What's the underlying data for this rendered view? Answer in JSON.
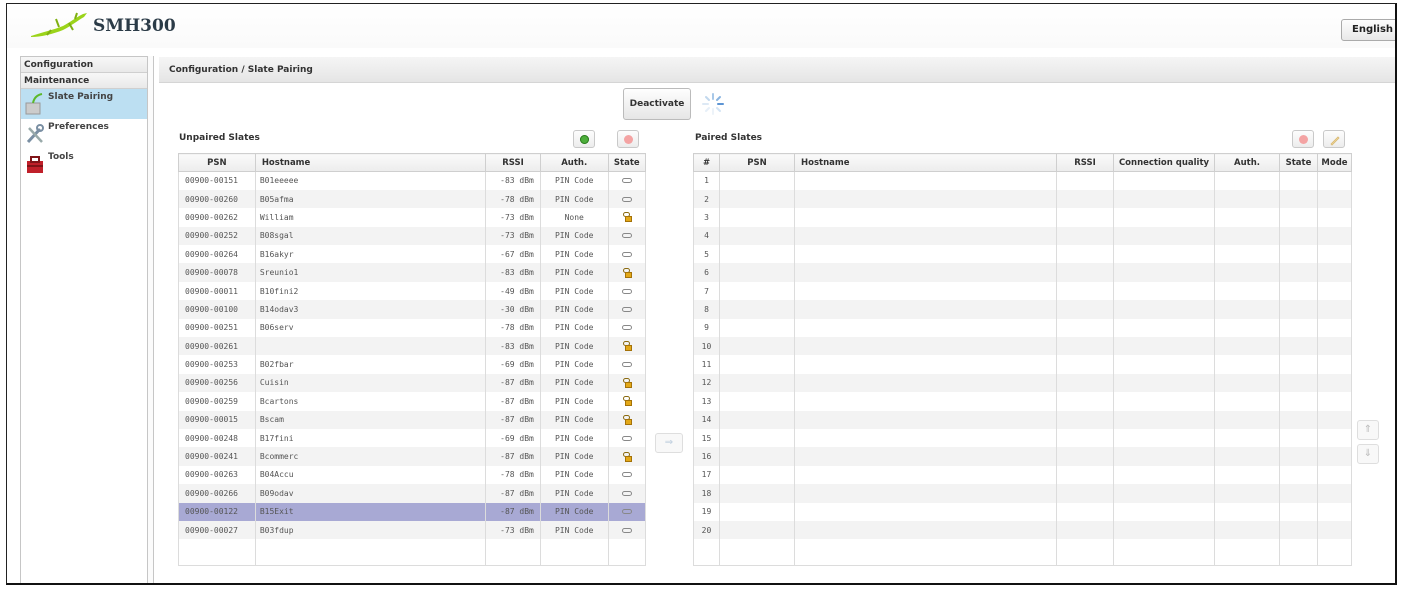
{
  "app": {
    "name": "SMH300"
  },
  "language": {
    "selected": "English"
  },
  "sidebar": {
    "sections": [
      {
        "label": "Configuration"
      },
      {
        "label": "Maintenance"
      }
    ],
    "items": [
      {
        "label": "Slate Pairing",
        "icon": "slate-pairing-icon",
        "active": true
      },
      {
        "label": "Preferences",
        "icon": "tools-wrench-icon"
      },
      {
        "label": "Tools",
        "icon": "toolbox-icon"
      }
    ]
  },
  "breadcrumb": "Configuration / Slate Pairing",
  "actions": {
    "deactivate_label": "Deactivate"
  },
  "unpaired": {
    "title": "Unpaired Slates",
    "columns": [
      "PSN",
      "Hostname",
      "RSSI",
      "Auth.",
      "State"
    ],
    "rows": [
      {
        "psn": "00900-00151",
        "host": "B01eeeee",
        "rssi": "-83 dBm",
        "auth": "PIN Code",
        "state": "link"
      },
      {
        "psn": "00900-00260",
        "host": "B05afma",
        "rssi": "-78 dBm",
        "auth": "PIN Code",
        "state": "link"
      },
      {
        "psn": "00900-00262",
        "host": "William",
        "rssi": "-73 dBm",
        "auth": "None",
        "state": "lock"
      },
      {
        "psn": "00900-00252",
        "host": "B08sgal",
        "rssi": "-73 dBm",
        "auth": "PIN Code",
        "state": "link"
      },
      {
        "psn": "00900-00264",
        "host": "B16akyr",
        "rssi": "-67 dBm",
        "auth": "PIN Code",
        "state": "link"
      },
      {
        "psn": "00900-00078",
        "host": "Sreunio1",
        "rssi": "-83 dBm",
        "auth": "PIN Code",
        "state": "lock"
      },
      {
        "psn": "00900-00011",
        "host": "B10fini2",
        "rssi": "-49 dBm",
        "auth": "PIN Code",
        "state": "link"
      },
      {
        "psn": "00900-00100",
        "host": "B14odav3",
        "rssi": "-30 dBm",
        "auth": "PIN Code",
        "state": "link"
      },
      {
        "psn": "00900-00251",
        "host": "B06serv",
        "rssi": "-78 dBm",
        "auth": "PIN Code",
        "state": "link"
      },
      {
        "psn": "00900-00261",
        "host": "",
        "rssi": "-83 dBm",
        "auth": "PIN Code",
        "state": "lock"
      },
      {
        "psn": "00900-00253",
        "host": "B02fbar",
        "rssi": "-69 dBm",
        "auth": "PIN Code",
        "state": "link"
      },
      {
        "psn": "00900-00256",
        "host": "Cuisin",
        "rssi": "-87 dBm",
        "auth": "PIN Code",
        "state": "lock"
      },
      {
        "psn": "00900-00259",
        "host": "Bcartons",
        "rssi": "-87 dBm",
        "auth": "PIN Code",
        "state": "lock"
      },
      {
        "psn": "00900-00015",
        "host": "Bscam",
        "rssi": "-87 dBm",
        "auth": "PIN Code",
        "state": "lock"
      },
      {
        "psn": "00900-00248",
        "host": "B17fini",
        "rssi": "-69 dBm",
        "auth": "PIN Code",
        "state": "link"
      },
      {
        "psn": "00900-00241",
        "host": "Bcommerc",
        "rssi": "-87 dBm",
        "auth": "PIN Code",
        "state": "lock"
      },
      {
        "psn": "00900-00263",
        "host": "B04Accu",
        "rssi": "-78 dBm",
        "auth": "PIN Code",
        "state": "link"
      },
      {
        "psn": "00900-00266",
        "host": "B09odav",
        "rssi": "-87 dBm",
        "auth": "PIN Code",
        "state": "link"
      },
      {
        "psn": "00900-00122",
        "host": "B15Exit",
        "rssi": "-87 dBm",
        "auth": "PIN Code",
        "state": "link",
        "selected": true
      },
      {
        "psn": "00900-00027",
        "host": "B03fdup",
        "rssi": "-73 dBm",
        "auth": "PIN Code",
        "state": "link"
      }
    ]
  },
  "paired": {
    "title": "Paired Slates",
    "columns": [
      "#",
      "PSN",
      "Hostname",
      "RSSI",
      "Connection quality",
      "Auth.",
      "State",
      "Mode"
    ],
    "rows": [
      "1",
      "2",
      "3",
      "4",
      "5",
      "6",
      "7",
      "8",
      "9",
      "10",
      "11",
      "12",
      "13",
      "14",
      "15",
      "16",
      "17",
      "18",
      "19",
      "20"
    ]
  },
  "colors": {
    "selected_row": "#a8a9d4",
    "active_nav": "#bcdff2",
    "add_green": "#4cae3a",
    "remove_red": "#f08b8b"
  }
}
